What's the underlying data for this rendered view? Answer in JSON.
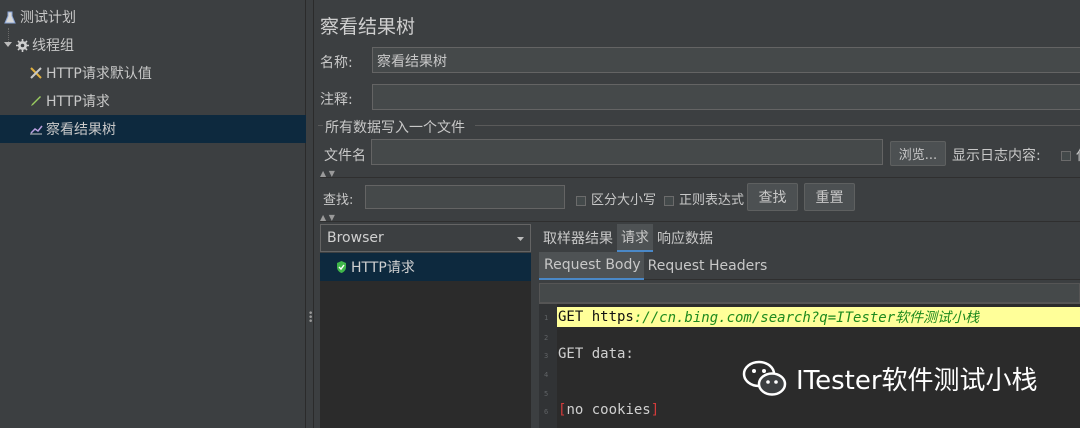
{
  "tree": {
    "items": [
      {
        "label": "测试计划",
        "icon": "flask-icon"
      },
      {
        "label": "线程组",
        "icon": "gear-icon"
      },
      {
        "label": "HTTP请求默认值",
        "icon": "tools-icon"
      },
      {
        "label": "HTTP请求",
        "icon": "pencil-icon"
      },
      {
        "label": "察看结果树",
        "icon": "chart-icon"
      }
    ]
  },
  "panel": {
    "title": "察看结果树",
    "name_label": "名称:",
    "name_value": "察看结果树",
    "comment_label": "注释:",
    "comment_value": "",
    "fieldset_title": "所有数据写入一个文件",
    "filename_label": "文件名",
    "filename_value": "",
    "browse_label": "浏览...",
    "log_label": "显示日志内容:",
    "log_extra": "仅"
  },
  "search": {
    "label": "查找:",
    "value": "",
    "case_label": "区分大小写",
    "regex_label": "正则表达式",
    "find_button": "查找",
    "reset_button": "重置"
  },
  "results": {
    "renderer": "Browser",
    "items": [
      "HTTP请求"
    ],
    "tabs": [
      "取样器结果",
      "请求",
      "响应数据"
    ],
    "active_tab": "请求",
    "subtabs": [
      "Request Body",
      "Request Headers"
    ],
    "active_subtab": "Request Body"
  },
  "editor": {
    "line1_prefix": "GET https",
    "line1_url": "://cn.bing.com/search?q=ITester软件测试小栈",
    "line3": "GET data:",
    "line6_text": "no cookies",
    "line_numbers": [
      "1",
      "2",
      "3",
      "4",
      "5",
      "6"
    ]
  },
  "watermark": {
    "text": "ITester软件测试小栈"
  },
  "colors": {
    "accent": "#4a88c7",
    "highlight": "#ffff99",
    "selection": "#0d293e"
  }
}
